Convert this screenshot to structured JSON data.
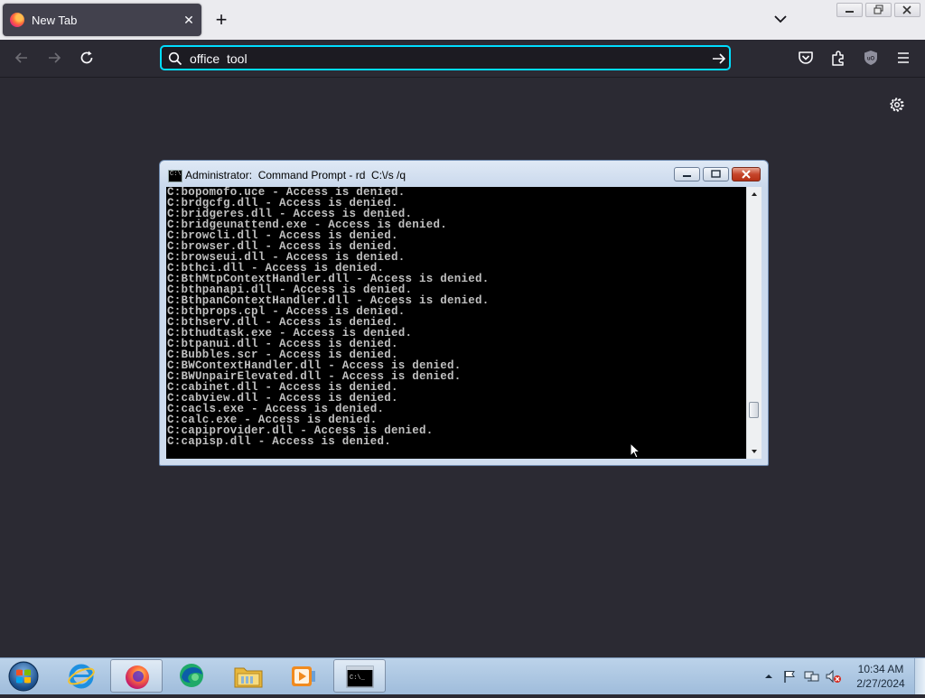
{
  "browser": {
    "tab": {
      "title": "New Tab",
      "close_icon": "close-icon",
      "favicon": "firefox-icon"
    },
    "new_tab_icon": "plus-icon",
    "tab_list_icon": "chevron-down-icon",
    "url_bar": {
      "value": "office  tool",
      "search_icon": "search-icon",
      "go_icon": "arrow-right-icon"
    },
    "nav_icons": [
      "back-arrow-icon",
      "forward-arrow-icon",
      "reload-icon"
    ],
    "toolbar_icons": [
      "pocket-icon",
      "extensions-icon",
      "ublock-origin-icon",
      "hamburger-menu-icon"
    ],
    "settings_icon": "gear-icon",
    "accent_color": "#00ddff"
  },
  "cmd_window": {
    "title": "Administrator:  Command Prompt - rd  C:\\/s /q",
    "icon_text": "C:\\",
    "lines": [
      "C:bopomofo.uce - Access is denied.",
      "C:brdgcfg.dll - Access is denied.",
      "C:bridgeres.dll - Access is denied.",
      "C:bridgeunattend.exe - Access is denied.",
      "C:browcli.dll - Access is denied.",
      "C:browser.dll - Access is denied.",
      "C:browseui.dll - Access is denied.",
      "C:bthci.dll - Access is denied.",
      "C:BthMtpContextHandler.dll - Access is denied.",
      "C:bthpanapi.dll - Access is denied.",
      "C:BthpanContextHandler.dll - Access is denied.",
      "C:bthprops.cpl - Access is denied.",
      "C:bthserv.dll - Access is denied.",
      "C:bthudtask.exe - Access is denied.",
      "C:btpanui.dll - Access is denied.",
      "C:Bubbles.scr - Access is denied.",
      "C:BWContextHandler.dll - Access is denied.",
      "C:BWUnpairElevated.dll - Access is denied.",
      "C:cabinet.dll - Access is denied.",
      "C:cabview.dll - Access is denied.",
      "C:cacls.exe - Access is denied.",
      "C:calc.exe - Access is denied.",
      "C:capiprovider.dll - Access is denied.",
      "C:capisp.dll - Access is denied."
    ]
  },
  "taskbar": {
    "items": [
      "start-orb-icon",
      "internet-explorer-icon",
      "firefox-icon",
      "edge-icon",
      "file-explorer-icon",
      "media-player-icon",
      "command-prompt-icon"
    ],
    "tray_icons": [
      "show-hidden-icons-arrow-icon",
      "action-center-flag-icon",
      "network-icon",
      "volume-muted-icon"
    ],
    "clock": {
      "time": "10:34 AM",
      "date": "2/27/2024"
    }
  }
}
